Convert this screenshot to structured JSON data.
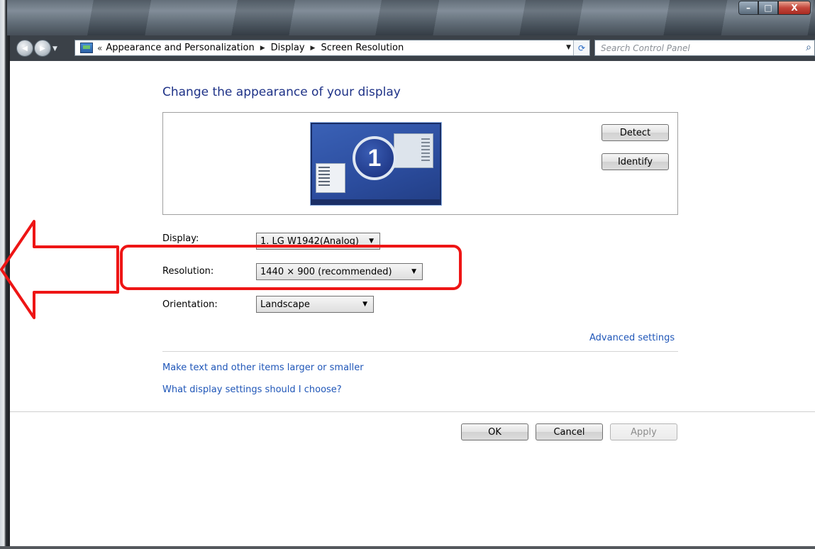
{
  "window": {
    "caption_buttons": {
      "minimize": "–",
      "maximize": "□",
      "close": "X"
    }
  },
  "nav": {
    "back_icon": "◀",
    "forward_icon": "▶",
    "history_dropdown": "▼",
    "breadcrumb_overflow": "«",
    "breadcrumb": [
      "Appearance and Personalization",
      "Display",
      "Screen Resolution"
    ],
    "crumb_separator": "▶",
    "address_dropdown": "▼",
    "refresh_icon": "⟳",
    "search": {
      "placeholder": "Search Control Panel",
      "icon": "⌕"
    }
  },
  "page": {
    "title": "Change the appearance of your display",
    "monitor_number": "1",
    "detect_label": "Detect",
    "identify_label": "Identify"
  },
  "form": {
    "display": {
      "label": "Display:",
      "value": "1. LG W1942(Analog)"
    },
    "resolution": {
      "label": "Resolution:",
      "value": "1440 × 900 (recommended)"
    },
    "orientation": {
      "label": "Orientation:",
      "value": "Landscape"
    },
    "dropdown_caret": "▼"
  },
  "links": {
    "advanced": "Advanced settings",
    "text_size": "Make text and other items larger or smaller",
    "choose": "What display settings should I choose?"
  },
  "buttons": {
    "ok": "OK",
    "cancel": "Cancel",
    "apply": "Apply"
  },
  "colors": {
    "link": "#1f56b8",
    "title": "#1e3287",
    "annotation": "#ee1515"
  },
  "icons": {
    "address_icon": "control-panel-icon",
    "search_icon": "search-icon",
    "refresh_icon": "refresh-icon"
  }
}
